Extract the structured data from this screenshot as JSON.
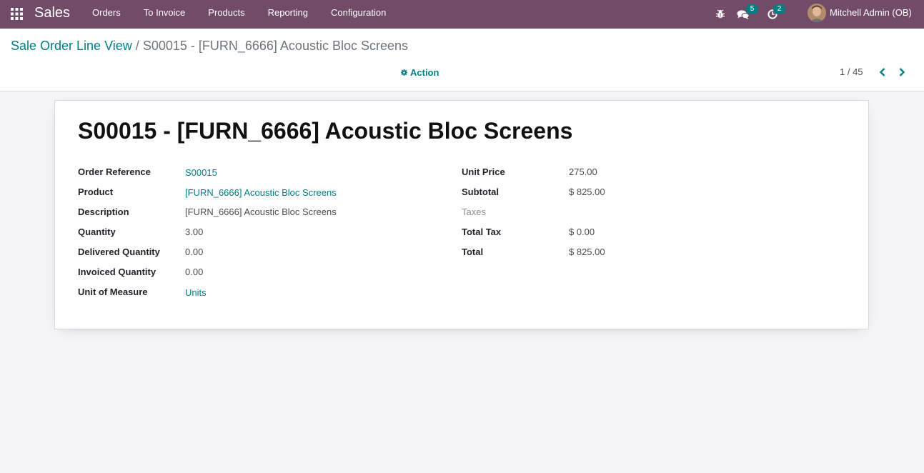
{
  "navbar": {
    "brand": "Sales",
    "menu": [
      "Orders",
      "To Invoice",
      "Products",
      "Reporting",
      "Configuration"
    ],
    "messages_count": "5",
    "activities_count": "2",
    "user": "Mitchell Admin (OB)",
    "bg_color": "#714b67"
  },
  "breadcrumb": {
    "parent": "Sale Order Line View",
    "separator": "/",
    "current": "S00015 - [FURN_6666] Acoustic Bloc Screens"
  },
  "control": {
    "action_label": "Action",
    "pager_value": "1 / 45"
  },
  "record": {
    "title": "S00015 - [FURN_6666] Acoustic Bloc Screens",
    "left_fields": [
      {
        "label": "Order Reference",
        "value": "S00015"
      },
      {
        "label": "Product",
        "value": "[FURN_6666] Acoustic Bloc Screens"
      },
      {
        "label": "Description",
        "value": "[FURN_6666] Acoustic Bloc Screens"
      },
      {
        "label": "Quantity",
        "value": "3.00"
      },
      {
        "label": "Delivered Quantity",
        "value": "0.00"
      },
      {
        "label": "Invoiced Quantity",
        "value": "0.00"
      },
      {
        "label": "Unit of Measure",
        "value": "Units"
      }
    ],
    "right_fields": [
      {
        "label": "Unit Price",
        "value": "275.00"
      },
      {
        "label": "Subtotal",
        "value": "$ 825.00"
      },
      {
        "label": "Taxes",
        "value": ""
      },
      {
        "label": "Total Tax",
        "value": "$ 0.00"
      },
      {
        "label": "Total",
        "value": "$ 825.00"
      }
    ]
  },
  "colors": {
    "accent": "#017e84",
    "primary": "#714b67"
  },
  "icons": [
    "apps-grid-icon",
    "bug-icon",
    "chat-icon",
    "clock-icon",
    "gear-icon",
    "chevron-left-icon",
    "chevron-right-icon"
  ]
}
